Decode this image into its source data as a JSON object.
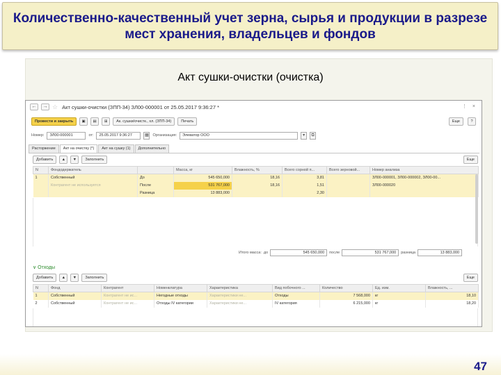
{
  "slide": {
    "title": "Количественно-качественный учет зерна, сырья и продукции в разрезе мест хранения, владельцев и фондов",
    "subtitle": "Акт сушки-очистки (очистка)",
    "page_number": "47"
  },
  "window": {
    "back": "←",
    "forward": "→",
    "star": "☆",
    "title": "Акт сушки-очистки (ЗПП-34) ЗЛ00-000001 от 25.05.2017 9:36:27 *",
    "link_icon": "⋮",
    "close": "×"
  },
  "toolbar": {
    "post_close": "Провести и закрыть",
    "save_icon": "▣",
    "post_icon": "▤",
    "structure_icon": "⊞",
    "doc_basis": "Ак. сушки/очистк., хл. (ЗПП-34)",
    "print": "Печать",
    "more": "Еще",
    "help": "?"
  },
  "header_fields": {
    "number_label": "Номер:",
    "number_value": "ЗЛ00-000001",
    "date_label": "от:",
    "date_value": "25.05.2017 9:36:27",
    "org_label": "Организация:",
    "org_value": "Элеватор ООО",
    "dropdown": "▾",
    "open": "⧉"
  },
  "tabs": [
    {
      "label": "Расторжение"
    },
    {
      "label": "Акт на очистку (*)"
    },
    {
      "label": "Акт на сушку (1)"
    },
    {
      "label": "Дополнительно"
    }
  ],
  "main_grid": {
    "add": "Добавить",
    "up": "▲",
    "down": "▼",
    "fill": "Заполнить",
    "more": "Еще",
    "columns": [
      "N",
      "Фондодержатель",
      "",
      "Масса, кг",
      "Влажность, %",
      "Всего сорной п...",
      "Всего зерновой...",
      "Номер анализа"
    ],
    "rows": [
      {
        "n": "1",
        "holder": "Собственный",
        "kind": "До",
        "mass": "545 650,000",
        "moisture": "18,16",
        "weed": "3,81",
        "grain": "",
        "analysis": "ЗЛ00-000001, ЗЛ00-000002, ЗЛ00-00..."
      },
      {
        "n": "",
        "holder": "Контрагент не используется",
        "kind": "После",
        "mass": "531 767,000",
        "moisture": "18,16",
        "weed": "1,51",
        "grain": "",
        "analysis": "ЗЛ00-000020"
      },
      {
        "n": "",
        "holder": "",
        "kind": "Разница",
        "mass": "13 883,000",
        "moisture": "",
        "weed": "2,30",
        "grain": "",
        "analysis": ""
      }
    ]
  },
  "totals": {
    "mass_label": "Итого масса:",
    "before_label": "до",
    "before_value": "545 650,000",
    "after_label": "после",
    "after_value": "531 767,000",
    "diff_label": "разница",
    "diff_value": "13 883,000"
  },
  "waste": {
    "section_title": "Отходы",
    "chevron": "∨",
    "add": "Добавить",
    "up": "▲",
    "down": "▼",
    "fill": "Заполнить",
    "more": "Еще",
    "columns": [
      "N",
      "Фонд",
      "Контрагент",
      "Номенклатура",
      "Характеристика",
      "Вид побочного ...",
      "Количество",
      "Ед. изм.",
      "Влажность, ..."
    ],
    "rows": [
      {
        "n": "1",
        "fund": "Собственный",
        "contractor": "Контрагент не ис...",
        "item": "Негодные отходы",
        "characteristic": "Характеристики не...",
        "kind": "Отходы",
        "qty": "7 568,000",
        "unit": "кг",
        "moisture": "18,10"
      },
      {
        "n": "2",
        "fund": "Собственный",
        "contractor": "Контрагент не ис...",
        "item": "Отходы IV категории",
        "characteristic": "Характеристики не...",
        "kind": "IV категория",
        "qty": "6 215,000",
        "unit": "кг",
        "moisture": "18,20"
      }
    ]
  },
  "colors": {
    "title_text": "#1a1a8a",
    "header_bg": "#f5f0c8",
    "selected_row": "#fbf2c4",
    "highlight_cell": "#f5d14a",
    "section_green": "#2a8a2a"
  }
}
